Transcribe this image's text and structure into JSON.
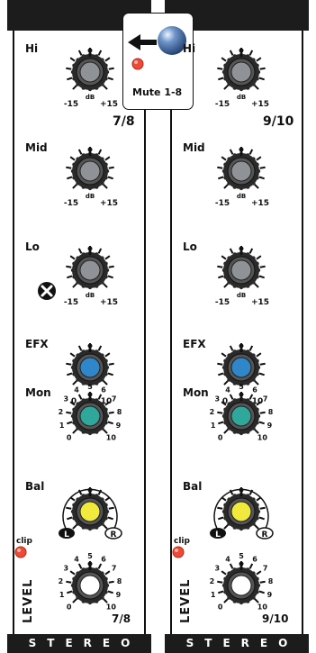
{
  "strips": [
    {
      "channel_top": "7/8",
      "channel_bottom": "7/8",
      "hi_label": "Hi",
      "mid_label": "Mid",
      "lo_label": "Lo",
      "efx_label": "EFX",
      "mon_label": "Mon",
      "bal_label": "Bal",
      "level_label": "LEVEL",
      "clip_label": "clip",
      "footer": "STEREO"
    },
    {
      "channel_top": "9/10",
      "channel_bottom": "9/10",
      "hi_label": "Hi",
      "mid_label": "Mid",
      "lo_label": "Lo",
      "efx_label": "EFX",
      "mon_label": "Mon",
      "bal_label": "Bal",
      "level_label": "LEVEL",
      "clip_label": "clip",
      "footer": "STEREO"
    }
  ],
  "eq_scale": {
    "min": "-15",
    "unit": "dB",
    "max": "+15"
  },
  "send_scale": {
    "min": "0",
    "max": "10"
  },
  "ring_scale": [
    "0",
    "1",
    "2",
    "3",
    "4",
    "5",
    "6",
    "7",
    "8",
    "9",
    "10"
  ],
  "bal_scale": {
    "left": "L",
    "right": "R"
  },
  "mute": {
    "label": "Mute 1-8"
  },
  "colors": {
    "eq_cap": "#8f9397",
    "efx_cap": "#2f86c8",
    "mon_cap": "#2fa79a",
    "bal_cap": "#f1ea3c",
    "level_cap": "#ffffff",
    "clip_led": "#f04a36",
    "panel_dark": "#1c1c1c"
  }
}
